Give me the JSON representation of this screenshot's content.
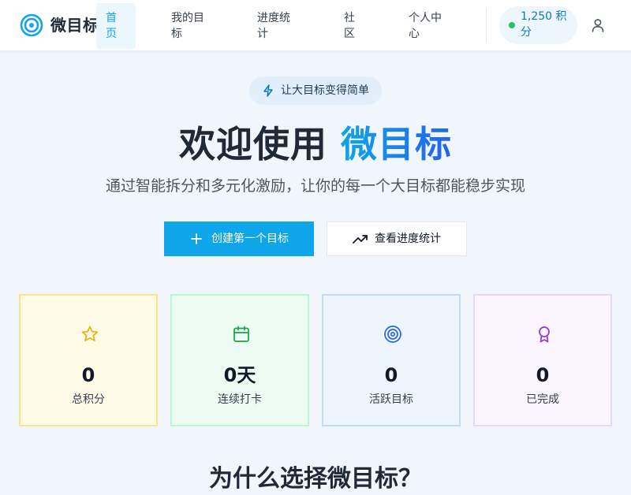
{
  "header": {
    "logo_text": "微目标",
    "nav": [
      {
        "label": "首页",
        "active": true
      },
      {
        "label": "我的目标",
        "active": false
      },
      {
        "label": "进度统计",
        "active": false
      },
      {
        "label": "社区",
        "active": false
      },
      {
        "label": "个人中心",
        "active": false
      }
    ],
    "points_label": "1,250 积分",
    "icons": {
      "logo": "target-icon",
      "user": "user-icon"
    }
  },
  "hero": {
    "slogan": "让大目标变得简单",
    "slogan_icon": "lightning-icon",
    "title_prefix": "欢迎使用 ",
    "title_brand": "微目标",
    "subtitle": "通过智能拆分和多元化激励，让你的每一个大目标都能稳步实现",
    "primary_button": "创建第一个目标",
    "secondary_button": "查看进度统计"
  },
  "stats": [
    {
      "value": "0",
      "label": "总积分",
      "icon": "star-icon",
      "color": "#eab308"
    },
    {
      "value": "0天",
      "label": "连续打卡",
      "icon": "calendar-icon",
      "color": "#16a34a"
    },
    {
      "value": "0",
      "label": "活跃目标",
      "icon": "target-icon",
      "color": "#2563eb"
    },
    {
      "value": "0",
      "label": "已完成",
      "icon": "award-icon",
      "color": "#9333ea"
    }
  ],
  "section": {
    "heading": "为什么选择微目标？"
  },
  "colors": {
    "accent": "#0ea5e9",
    "points_dot": "#22c55e"
  }
}
